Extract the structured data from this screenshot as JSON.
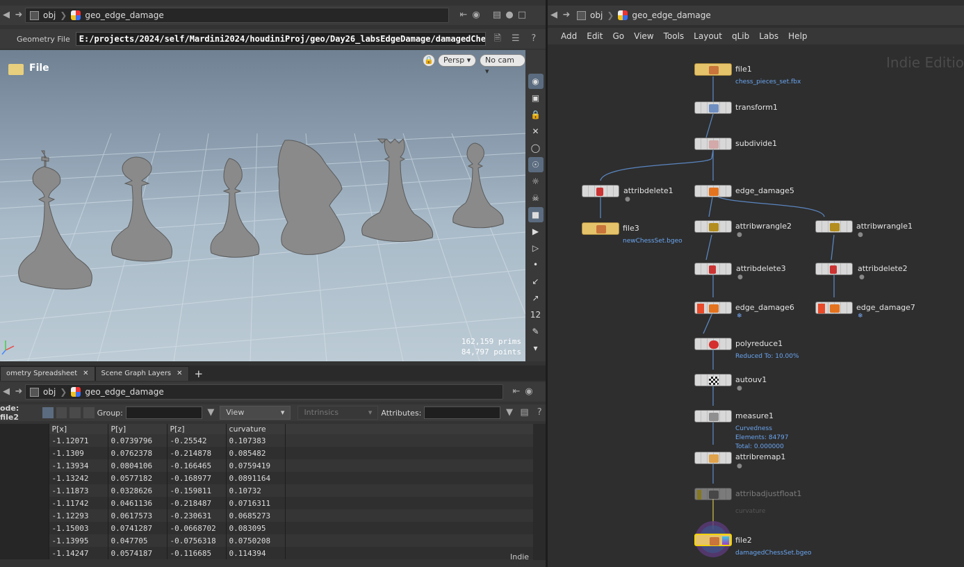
{
  "left_pane": {
    "path": {
      "context": "obj",
      "node": "geo_edge_damage"
    },
    "geometry_file": {
      "label": "Geometry File",
      "value": "E:/projects/2024/self/Mardini2024/houdiniProj/geo/Day26_labsEdgeDamage/damagedChe"
    },
    "viewport": {
      "title": "File",
      "persp_button": "Persp ▾",
      "cam_button": "No cam ▾",
      "stats_prims": "162,159  prims",
      "stats_points": "84,797 points"
    },
    "tabs": [
      "ometry Spreadsheet",
      "Scene Graph Layers"
    ],
    "tab_add": "+",
    "spreadsheet_path": {
      "context": "obj",
      "node": "geo_edge_damage"
    },
    "spreadsheet_bar": {
      "node_label": "ode: file2",
      "group_label": "Group:",
      "view_label": "View",
      "intrinsics_label": "Intrinsics",
      "attributes_label": "Attributes:"
    },
    "table": {
      "columns": [
        "P[x]",
        "P[y]",
        "P[z]",
        "curvature"
      ],
      "rows": [
        [
          "-1.12071",
          "0.0739796",
          "-0.25542",
          "0.107383"
        ],
        [
          "-1.1309",
          "0.0762378",
          "-0.214878",
          "0.085482"
        ],
        [
          "-1.13934",
          "0.0804106",
          "-0.166465",
          "0.0759419"
        ],
        [
          "-1.13242",
          "0.0577182",
          "-0.168977",
          "0.0891164"
        ],
        [
          "-1.11873",
          "0.0328626",
          "-0.159811",
          "0.10732"
        ],
        [
          "-1.11742",
          "0.0461136",
          "-0.218487",
          "0.0716311"
        ],
        [
          "-1.12293",
          "0.0617573",
          "-0.230631",
          "0.0685273"
        ],
        [
          "-1.15003",
          "0.0741287",
          "-0.0668702",
          "0.083095"
        ],
        [
          "-1.13995",
          "0.047705",
          "-0.0756318",
          "0.0750208"
        ],
        [
          "-1.14247",
          "0.0574187",
          "-0.116685",
          "0.114394"
        ]
      ]
    },
    "footer_label": "Indie"
  },
  "right_pane": {
    "path": {
      "context": "obj",
      "node": "geo_edge_damage"
    },
    "menu": [
      "Add",
      "Edit",
      "Go",
      "View",
      "Tools",
      "Layout",
      "qLib",
      "Labs",
      "Help"
    ],
    "watermark": "Indie Editio",
    "nodes": {
      "file1": {
        "label": "file1",
        "sub": "chess_pieces_set.fbx"
      },
      "transform1": {
        "label": "transform1"
      },
      "subdivide1": {
        "label": "subdivide1"
      },
      "attribdelete1": {
        "label": "attribdelete1"
      },
      "file3": {
        "label": "file3",
        "sub": "newChessSet.bgeo"
      },
      "edge_damage5": {
        "label": "edge_damage5"
      },
      "attribwrangle2": {
        "label": "attribwrangle2"
      },
      "attribwrangle1": {
        "label": "attribwrangle1"
      },
      "attribdelete3": {
        "label": "attribdelete3"
      },
      "attribdelete2": {
        "label": "attribdelete2"
      },
      "edge_damage6": {
        "label": "edge_damage6"
      },
      "edge_damage7": {
        "label": "edge_damage7"
      },
      "polyreduce1": {
        "label": "polyreduce1",
        "sub": "Reduced To: 10.00%"
      },
      "autouv1": {
        "label": "autouv1"
      },
      "measure1": {
        "label": "measure1",
        "sub1": "Curvedness",
        "sub2": "Elements: 84797",
        "sub3": "Total: 0.000000"
      },
      "attribremap1": {
        "label": "attribremap1"
      },
      "attribadjustfloat1": {
        "label": "attribadjustfloat1",
        "sub": "curvature"
      },
      "file2": {
        "label": "file2",
        "sub": "damagedChessSet.bgeo"
      }
    }
  }
}
